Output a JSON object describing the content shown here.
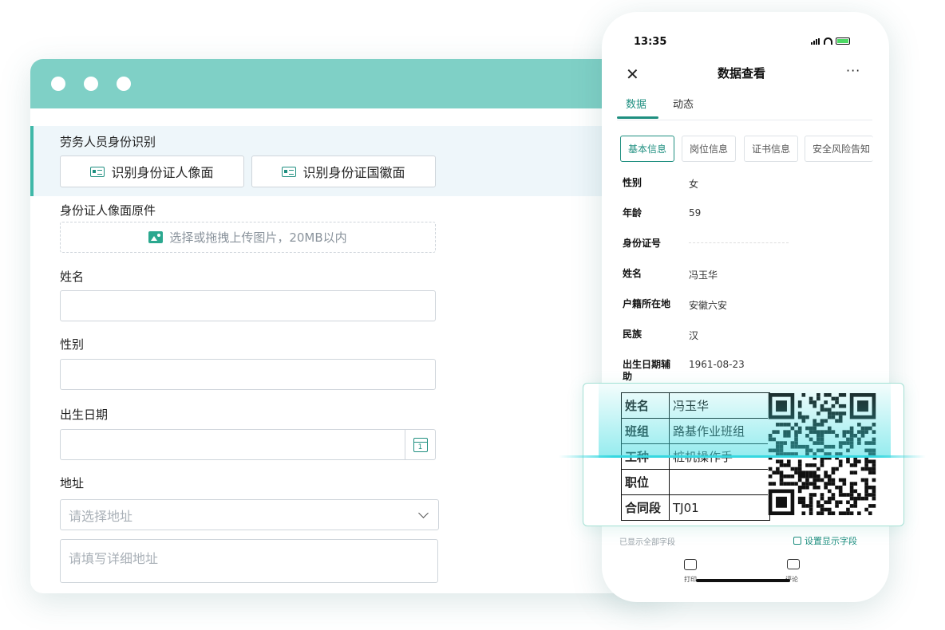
{
  "form": {
    "section_title": "劳务人员身份识别",
    "btn_portrait": "识别身份证人像面",
    "btn_emblem": "识别身份证国徽面",
    "upload_label": "身份证人像面原件",
    "upload_hint": "选择或拖拽上传图片，20MB以内",
    "name_label": "姓名",
    "gender_label": "性别",
    "birth_label": "出生日期",
    "address_label": "地址",
    "address_select_placeholder": "请选择地址",
    "address_detail_placeholder": "请填写详细地址"
  },
  "phone": {
    "time": "13:35",
    "title": "数据查看",
    "close": "✕",
    "more": "···",
    "tabs": [
      "数据",
      "动态"
    ],
    "subtabs": [
      "基本信息",
      "岗位信息",
      "证书信息",
      "安全风险告知"
    ],
    "fields": [
      {
        "key": "性别",
        "value": "女"
      },
      {
        "key": "年龄",
        "value": "59"
      },
      {
        "key": "身份证号",
        "value": ""
      },
      {
        "key": "姓名",
        "value": "冯玉华"
      },
      {
        "key": "户籍所在地",
        "value": "安徽六安"
      },
      {
        "key": "民族",
        "value": "汉"
      },
      {
        "key": "出生日期辅助",
        "value": "1961-08-23"
      }
    ],
    "footer_left": "已显示全部字段",
    "footer_right": "设置显示字段",
    "print_label": "打印",
    "comment_label": "评论"
  },
  "badge": {
    "rows": [
      {
        "key": "姓名",
        "value": "冯玉华"
      },
      {
        "key": "班组",
        "value": "路基作业班组"
      },
      {
        "key": "工种",
        "value": "桩机操作手"
      },
      {
        "key": "职位",
        "value": ""
      },
      {
        "key": "合同段",
        "value": "TJ01"
      }
    ]
  },
  "colors": {
    "accent": "#1f8f80",
    "window_bar": "#7fd0c6",
    "scan_line": "#36d8e0"
  }
}
